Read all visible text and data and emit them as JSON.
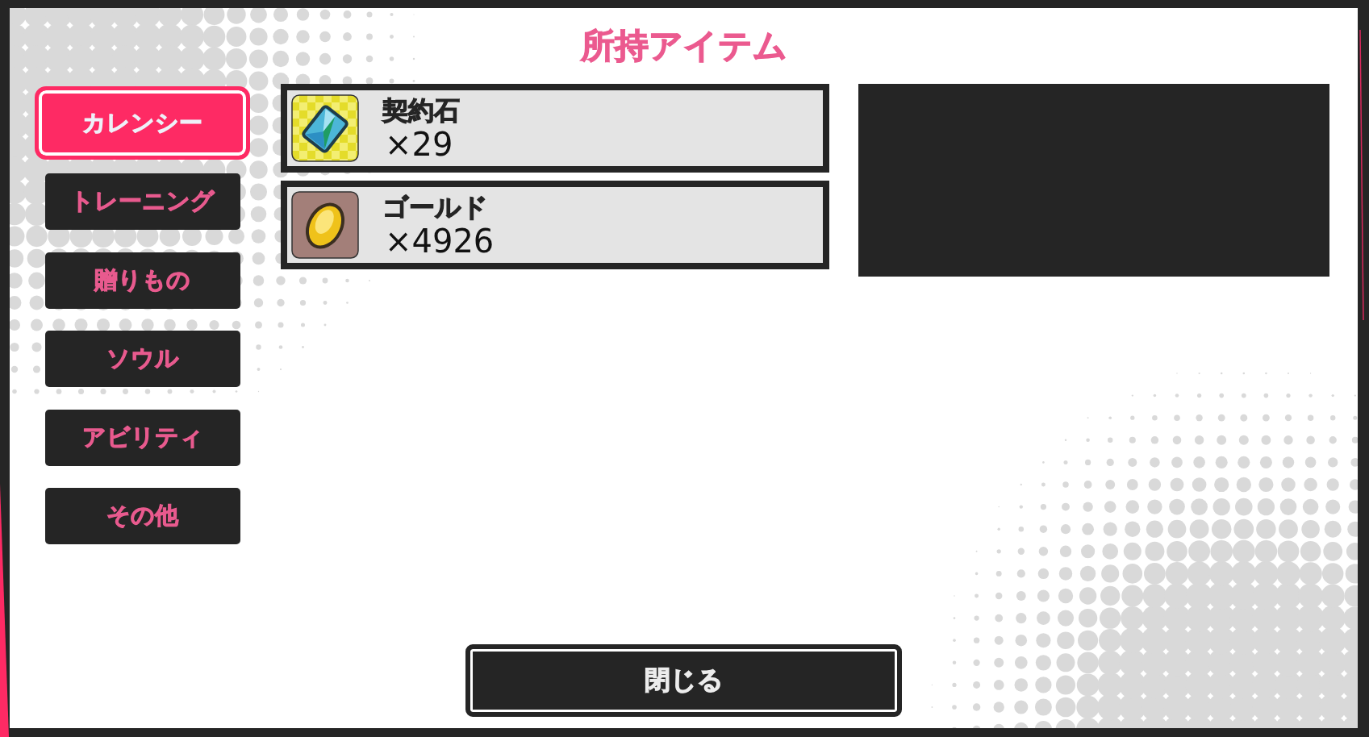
{
  "title": "所持アイテム",
  "tabs": [
    {
      "label": "カレンシー",
      "selected": true
    },
    {
      "label": "トレーニング",
      "selected": false
    },
    {
      "label": "贈りもの",
      "selected": false
    },
    {
      "label": "ソウル",
      "selected": false
    },
    {
      "label": "アビリティ",
      "selected": false
    },
    {
      "label": "その他",
      "selected": false
    }
  ],
  "items": [
    {
      "kind": "gem",
      "name": "契約石",
      "count": "×29"
    },
    {
      "kind": "coin",
      "name": "ゴールド",
      "count": "×4926"
    }
  ],
  "close_button": {
    "label": "閉じる"
  }
}
